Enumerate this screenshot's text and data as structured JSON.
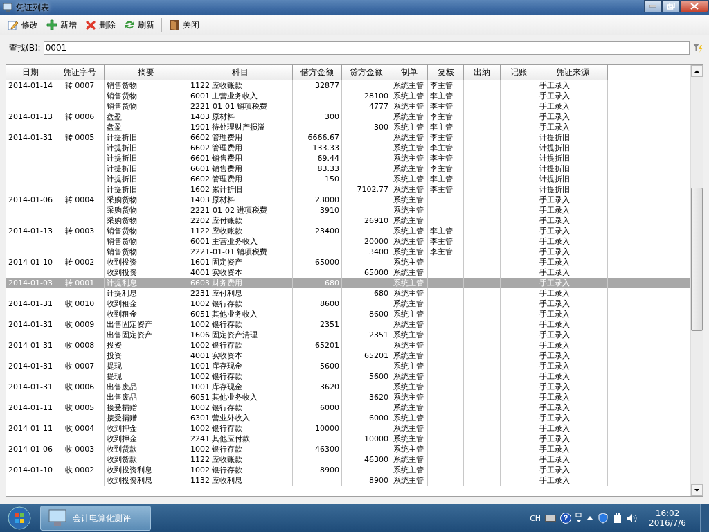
{
  "window": {
    "title": "凭证列表"
  },
  "toolbar": [
    "修改",
    "新增",
    "删除",
    "刷新",
    "关闭"
  ],
  "search": {
    "label": "查找(B):",
    "value": "0001"
  },
  "table": {
    "columns": [
      "日期",
      "凭证字号",
      "摘要",
      "科目",
      "借方金额",
      "贷方金额",
      "制单",
      "复核",
      "出纳",
      "记账",
      "凭证来源"
    ],
    "rows": [
      {
        "date": "2014-01-14",
        "voucher": "转 0007",
        "summary": "销售货物",
        "account": "1122 应收账款",
        "debit": "32877",
        "maker": "系统主管",
        "reviewer": "李主管",
        "source": "手工录入",
        "selected": false
      },
      {
        "summary": "销售货物",
        "account": "6001 主营业务收入",
        "credit": "28100",
        "maker": "系统主管",
        "reviewer": "李主管",
        "source": "手工录入",
        "selected": false
      },
      {
        "summary": "销售货物",
        "account": "2221-01-01 销项税费",
        "credit": "4777",
        "maker": "系统主管",
        "reviewer": "李主管",
        "source": "手工录入",
        "selected": false
      },
      {
        "date": "2014-01-13",
        "voucher": "转 0006",
        "summary": "盘盈",
        "account": "1403 原材料",
        "debit": "300",
        "maker": "系统主管",
        "reviewer": "李主管",
        "source": "手工录入",
        "selected": false
      },
      {
        "summary": "盘盈",
        "account": "1901 待处理财产损溢",
        "credit": "300",
        "maker": "系统主管",
        "reviewer": "李主管",
        "source": "手工录入",
        "selected": false
      },
      {
        "date": "2014-01-31",
        "voucher": "转 0005",
        "summary": "计提折旧",
        "account": "6602 管理费用",
        "debit": "6666.67",
        "maker": "系统主管",
        "reviewer": "李主管",
        "source": "计提折旧",
        "selected": false
      },
      {
        "summary": "计提折旧",
        "account": "6602 管理费用",
        "debit": "133.33",
        "maker": "系统主管",
        "reviewer": "李主管",
        "source": "计提折旧",
        "selected": false
      },
      {
        "summary": "计提折旧",
        "account": "6601 销售费用",
        "debit": "69.44",
        "maker": "系统主管",
        "reviewer": "李主管",
        "source": "计提折旧",
        "selected": false
      },
      {
        "summary": "计提折旧",
        "account": "6601 销售费用",
        "debit": "83.33",
        "maker": "系统主管",
        "reviewer": "李主管",
        "source": "计提折旧",
        "selected": false
      },
      {
        "summary": "计提折旧",
        "account": "6602 管理费用",
        "debit": "150",
        "maker": "系统主管",
        "reviewer": "李主管",
        "source": "计提折旧",
        "selected": false
      },
      {
        "summary": "计提折旧",
        "account": "1602 累计折旧",
        "credit": "7102.77",
        "maker": "系统主管",
        "reviewer": "李主管",
        "source": "计提折旧",
        "selected": false
      },
      {
        "date": "2014-01-06",
        "voucher": "转 0004",
        "summary": "采购货物",
        "account": "1403 原材料",
        "debit": "23000",
        "maker": "系统主管",
        "source": "手工录入",
        "selected": false
      },
      {
        "summary": "采购货物",
        "account": "2221-01-02 进项税费",
        "debit": "3910",
        "maker": "系统主管",
        "source": "手工录入",
        "selected": false
      },
      {
        "summary": "采购货物",
        "account": "2202 应付账款",
        "credit": "26910",
        "maker": "系统主管",
        "source": "手工录入",
        "selected": false
      },
      {
        "date": "2014-01-13",
        "voucher": "转 0003",
        "summary": "销售货物",
        "account": "1122 应收账款",
        "debit": "23400",
        "maker": "系统主管",
        "reviewer": "李主管",
        "source": "手工录入",
        "selected": false
      },
      {
        "summary": "销售货物",
        "account": "6001 主营业务收入",
        "credit": "20000",
        "maker": "系统主管",
        "reviewer": "李主管",
        "source": "手工录入",
        "selected": false
      },
      {
        "summary": "销售货物",
        "account": "2221-01-01 销项税费",
        "credit": "3400",
        "maker": "系统主管",
        "reviewer": "李主管",
        "source": "手工录入",
        "selected": false
      },
      {
        "date": "2014-01-10",
        "voucher": "转 0002",
        "summary": "收到投资",
        "account": "1601 固定资产",
        "debit": "65000",
        "maker": "系统主管",
        "source": "手工录入",
        "selected": false
      },
      {
        "summary": "收到投资",
        "account": "4001 实收资本",
        "credit": "65000",
        "maker": "系统主管",
        "source": "手工录入",
        "selected": false
      },
      {
        "date": "2014-01-03",
        "voucher": "转 0001",
        "summary": "计提利息",
        "account": "6603 财务费用",
        "debit": "680",
        "maker": "系统主管",
        "source": "手工录入",
        "selected": true
      },
      {
        "summary": "计提利息",
        "account": "2231 应付利息",
        "credit": "680",
        "maker": "系统主管",
        "source": "手工录入",
        "selected": false
      },
      {
        "date": "2014-01-31",
        "voucher": "收 0010",
        "summary": "收到租金",
        "account": "1002 银行存款",
        "debit": "8600",
        "maker": "系统主管",
        "source": "手工录入",
        "selected": false
      },
      {
        "summary": "收到租金",
        "account": "6051 其他业务收入",
        "credit": "8600",
        "maker": "系统主管",
        "source": "手工录入",
        "selected": false
      },
      {
        "date": "2014-01-31",
        "voucher": "收 0009",
        "summary": "出售固定资产",
        "account": "1002 银行存款",
        "debit": "2351",
        "maker": "系统主管",
        "source": "手工录入",
        "selected": false
      },
      {
        "summary": "出售固定资产",
        "account": "1606 固定资产清理",
        "credit": "2351",
        "maker": "系统主管",
        "source": "手工录入",
        "selected": false
      },
      {
        "date": "2014-01-31",
        "voucher": "收 0008",
        "summary": "投资",
        "account": "1002 银行存款",
        "debit": "65201",
        "maker": "系统主管",
        "source": "手工录入",
        "selected": false
      },
      {
        "summary": "投资",
        "account": "4001 实收资本",
        "credit": "65201",
        "maker": "系统主管",
        "source": "手工录入",
        "selected": false
      },
      {
        "date": "2014-01-31",
        "voucher": "收 0007",
        "summary": "提现",
        "account": "1001 库存现金",
        "debit": "5600",
        "maker": "系统主管",
        "source": "手工录入",
        "selected": false
      },
      {
        "summary": "提现",
        "account": "1002 银行存款",
        "credit": "5600",
        "maker": "系统主管",
        "source": "手工录入",
        "selected": false
      },
      {
        "date": "2014-01-31",
        "voucher": "收 0006",
        "summary": "出售废品",
        "account": "1001 库存现金",
        "debit": "3620",
        "maker": "系统主管",
        "source": "手工录入",
        "selected": false
      },
      {
        "summary": "出售废品",
        "account": "6051 其他业务收入",
        "credit": "3620",
        "maker": "系统主管",
        "source": "手工录入",
        "selected": false
      },
      {
        "date": "2014-01-11",
        "voucher": "收 0005",
        "summary": "接受捐赠",
        "account": "1002 银行存款",
        "debit": "6000",
        "maker": "系统主管",
        "source": "手工录入",
        "selected": false
      },
      {
        "summary": "接受捐赠",
        "account": "6301 营业外收入",
        "credit": "6000",
        "maker": "系统主管",
        "source": "手工录入",
        "selected": false
      },
      {
        "date": "2014-01-11",
        "voucher": "收 0004",
        "summary": "收到押金",
        "account": "1002 银行存款",
        "debit": "10000",
        "maker": "系统主管",
        "source": "手工录入",
        "selected": false
      },
      {
        "summary": "收到押金",
        "account": "2241 其他应付款",
        "credit": "10000",
        "maker": "系统主管",
        "source": "手工录入",
        "selected": false
      },
      {
        "date": "2014-01-06",
        "voucher": "收 0003",
        "summary": "收到货款",
        "account": "1002 银行存款",
        "debit": "46300",
        "maker": "系统主管",
        "source": "手工录入",
        "selected": false
      },
      {
        "summary": "收到货款",
        "account": "1122 应收账款",
        "credit": "46300",
        "maker": "系统主管",
        "source": "手工录入",
        "selected": false
      },
      {
        "date": "2014-01-10",
        "voucher": "收 0002",
        "summary": "收到投资利息",
        "account": "1002 银行存款",
        "debit": "8900",
        "maker": "系统主管",
        "source": "手工录入",
        "selected": false
      },
      {
        "summary": "收到投资利息",
        "account": "1132 应收利息",
        "credit": "8900",
        "maker": "系统主管",
        "source": "手工录入",
        "selected": false
      }
    ]
  },
  "taskbar": {
    "app": "会计电算化测评",
    "language": "CH",
    "time": "16:02",
    "date": "2016/7/6"
  }
}
